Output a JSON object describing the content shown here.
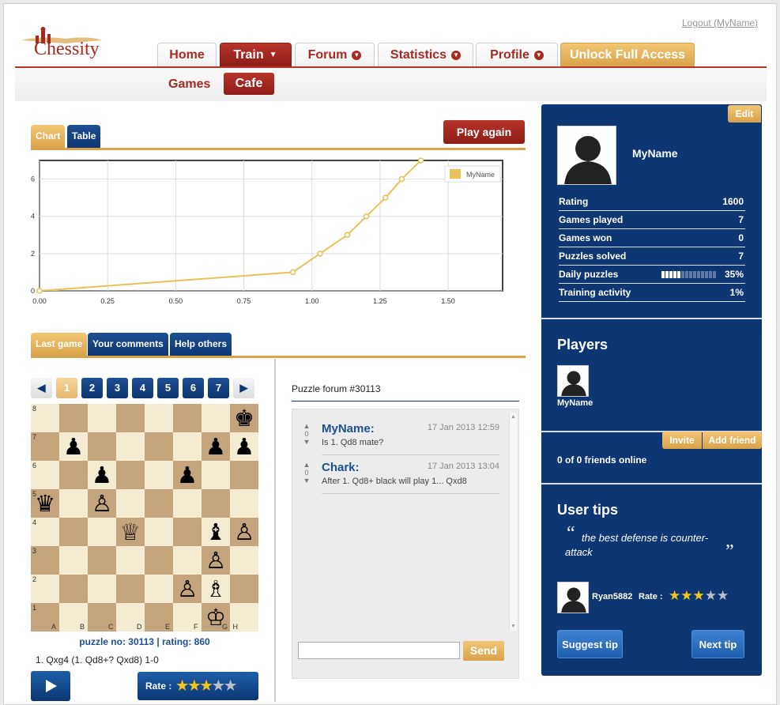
{
  "header": {
    "logo_text": "Chessity",
    "logout": "Logout (MyName)",
    "nav": [
      {
        "label": "Home",
        "dropdown": false
      },
      {
        "label": "Train",
        "dropdown": true,
        "active": true
      },
      {
        "label": "Forum",
        "dropdown": true
      },
      {
        "label": "Statistics",
        "dropdown": true
      },
      {
        "label": "Profile",
        "dropdown": true
      },
      {
        "label": "Unlock Full Access",
        "dropdown": false
      }
    ],
    "subnav": {
      "games": "Games",
      "cafe": "Cafe"
    }
  },
  "chart_panel": {
    "tabs": {
      "chart": "Chart",
      "table": "Table"
    },
    "play_again": "Play again"
  },
  "chart_data": {
    "type": "line",
    "series": [
      {
        "name": "MyName",
        "x": [
          0.0,
          0.93,
          1.03,
          1.13,
          1.2,
          1.27,
          1.33,
          1.4
        ],
        "y": [
          0,
          1,
          2,
          3,
          4,
          5,
          6,
          7
        ]
      }
    ],
    "xticks": [
      "0.00",
      "0.25",
      "0.50",
      "0.75",
      "1.00",
      "1.25",
      "1.50"
    ],
    "yticks": [
      "0",
      "2",
      "4",
      "6"
    ],
    "xlim": [
      0,
      1.7
    ],
    "ylim": [
      0,
      7
    ],
    "grid": true,
    "legend": "top-right",
    "color": "#e8c15a"
  },
  "game_panel": {
    "tabs": {
      "last_game": "Last game",
      "your_comments": "Your comments",
      "help_others": "Help others"
    },
    "pages": [
      "1",
      "2",
      "3",
      "4",
      "5",
      "6",
      "7"
    ],
    "files": [
      "A",
      "B",
      "C",
      "D",
      "E",
      "F",
      "G",
      "H"
    ],
    "ranks": [
      "8",
      "7",
      "6",
      "5",
      "4",
      "3",
      "2",
      "1"
    ],
    "pieces": [
      {
        "sq": "h8",
        "g": "♚"
      },
      {
        "sq": "b7",
        "g": "♟"
      },
      {
        "sq": "g7",
        "g": "♟"
      },
      {
        "sq": "h7",
        "g": "♟"
      },
      {
        "sq": "c6",
        "g": "♟"
      },
      {
        "sq": "f6",
        "g": "♟"
      },
      {
        "sq": "a5",
        "g": "♛"
      },
      {
        "sq": "c5",
        "g": "♙"
      },
      {
        "sq": "d4",
        "g": "♕"
      },
      {
        "sq": "g4",
        "g": "♝"
      },
      {
        "sq": "h4",
        "g": "♙"
      },
      {
        "sq": "g3",
        "g": "♙"
      },
      {
        "sq": "f2",
        "g": "♙"
      },
      {
        "sq": "g2",
        "g": "♗"
      },
      {
        "sq": "g1",
        "g": "♔"
      }
    ],
    "puzzle_no": "puzzle no: 30113",
    "separator": " | ",
    "rating": "rating: 860",
    "moves": "1. Qxg4 (1. Qd8+? Qxd8) 1-0",
    "rate_label": "Rate :",
    "rate_stars": 3
  },
  "forum": {
    "title": "Puzzle forum #30113",
    "posts": [
      {
        "user": "MyName:",
        "date": "17 Jan 2013 12:59",
        "text": "Is 1. Qd8 mate?",
        "votes": "0"
      },
      {
        "user": "Chark:",
        "date": "17 Jan 2013 13:04",
        "text": "After 1. Qd8+ black will play 1... Qxd8",
        "votes": "0"
      }
    ],
    "input_placeholder": "",
    "send": "Send"
  },
  "profile": {
    "edit": "Edit",
    "name": "MyName",
    "stats": [
      {
        "label": "Rating",
        "value": "1600"
      },
      {
        "label": "Games played",
        "value": "7"
      },
      {
        "label": "Games won",
        "value": "0"
      },
      {
        "label": "Puzzles solved",
        "value": "7"
      },
      {
        "label": "Daily puzzles",
        "value": "35%"
      },
      {
        "label": "Training activity",
        "value": "1%"
      }
    ],
    "daily_puzzles_progress": 0.35
  },
  "players": {
    "title": "Players",
    "list": [
      {
        "name": "MyName"
      }
    ],
    "invite": "Invite",
    "add_friend": "Add friend",
    "friends_online": "0 of 0 friends online"
  },
  "tips": {
    "title": "User tips",
    "quote": "the best defense is counter-attack",
    "author": "Ryan5882",
    "rate_label": "Rate :",
    "rate_stars": 3,
    "suggest": "Suggest tip",
    "next": "Next tip"
  },
  "colors": {
    "brand_red": "#a52a1f",
    "brand_blue": "#0c3772",
    "gold": "#d9a24a"
  }
}
